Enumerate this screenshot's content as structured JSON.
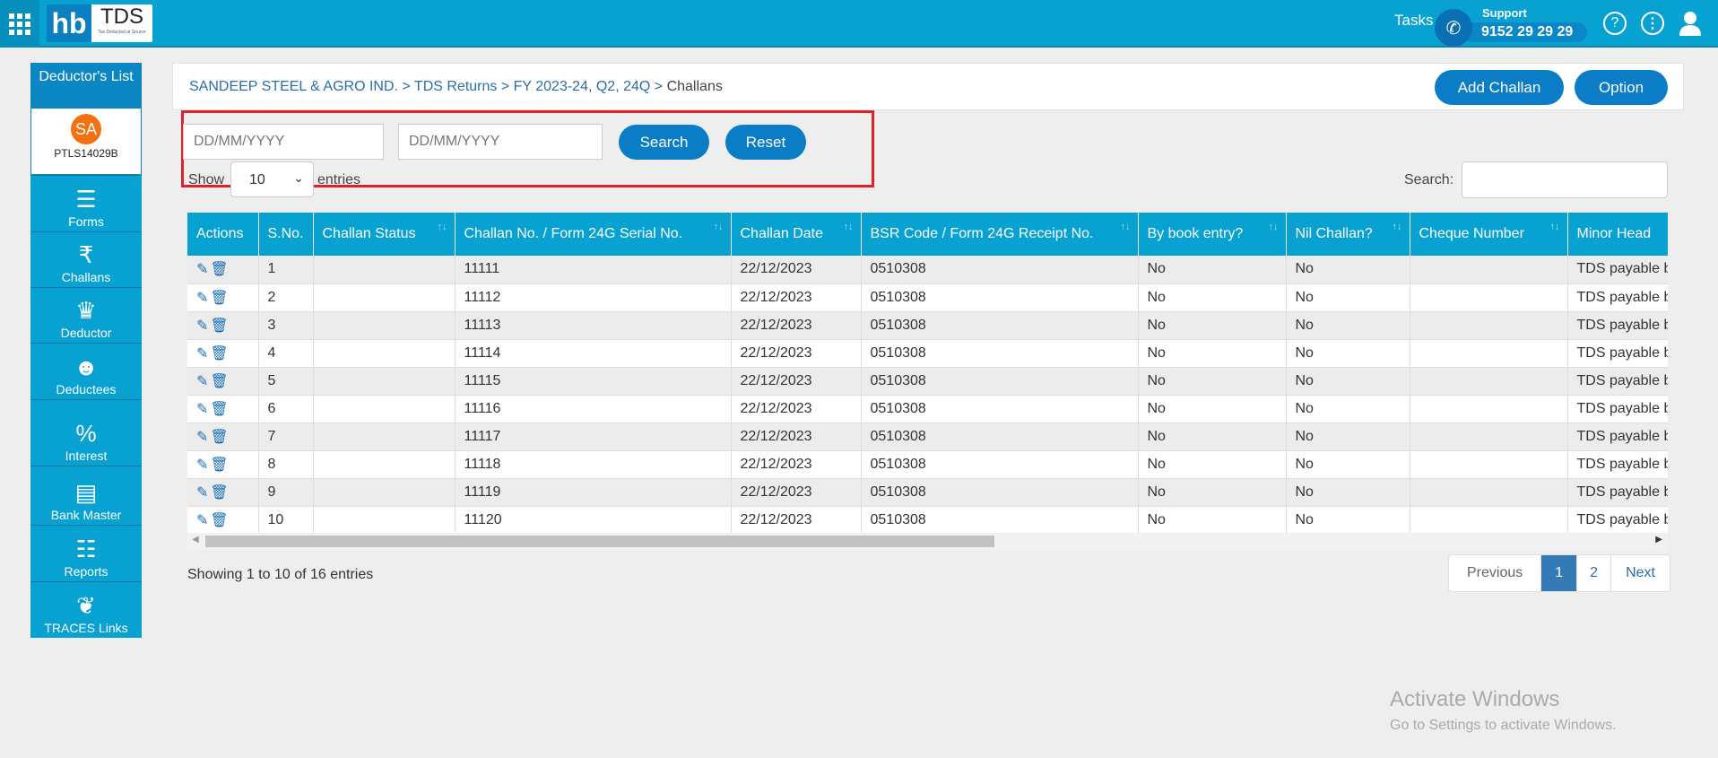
{
  "topbar": {
    "logo": {
      "hb": "hb",
      "tds": "TDS",
      "tagline": "Tax Deducted at Source"
    },
    "tasks_label": "Tasks",
    "support_label": "Support",
    "support_number": "9152 29 29 29",
    "icons": [
      "apps-grid-icon",
      "phone-icon",
      "help-icon",
      "more-vertical-icon",
      "user-icon"
    ]
  },
  "sidebar": {
    "header": "Deductor's List",
    "avatar_initials": "SA",
    "avatar_color": "#f5700f",
    "deductor_code": "PTLS14029B",
    "items": [
      {
        "label": "Forms",
        "icon": "forms-icon"
      },
      {
        "label": "Challans",
        "icon": "challan-receipt-icon"
      },
      {
        "label": "Deductor",
        "icon": "crown-icon"
      },
      {
        "label": "Deductees",
        "icon": "person-icon"
      },
      {
        "label": "Interest",
        "icon": "money-bag-icon"
      },
      {
        "label": "Bank Master",
        "icon": "bank-document-icon"
      },
      {
        "label": "Reports",
        "icon": "report-clipboard-icon"
      },
      {
        "label": "TRACES Links",
        "icon": "traces-logo-icon"
      }
    ]
  },
  "breadcrumb": {
    "items": [
      "SANDEEP STEEL & AGRO IND.",
      "TDS Returns",
      "FY 2023-24, Q2, 24Q"
    ],
    "separator": ">",
    "current": "Challans"
  },
  "actions": {
    "add_challan": "Add Challan",
    "option": "Option"
  },
  "filter": {
    "from_placeholder": "DD/MM/YYYY",
    "to_placeholder": "DD/MM/YYYY",
    "search_button": "Search",
    "reset_button": "Reset",
    "highlight_color": "#e02027"
  },
  "length": {
    "show": "Show",
    "value": "10",
    "entries": "entries"
  },
  "search": {
    "label": "Search:",
    "value": ""
  },
  "table": {
    "columns": [
      "Actions",
      "S.No.",
      "Challan Status",
      "Challan No. / Form 24G Serial No.",
      "Challan Date",
      "BSR Code / Form 24G Receipt No.",
      "By book entry?",
      "Nil Challan?",
      "Cheque Number",
      "Minor Head"
    ],
    "rows": [
      [
        "1",
        "",
        "11111",
        "22/12/2023",
        "0510308",
        "No",
        "No",
        "",
        "TDS payable by"
      ],
      [
        "2",
        "",
        "11112",
        "22/12/2023",
        "0510308",
        "No",
        "No",
        "",
        "TDS payable by"
      ],
      [
        "3",
        "",
        "11113",
        "22/12/2023",
        "0510308",
        "No",
        "No",
        "",
        "TDS payable by"
      ],
      [
        "4",
        "",
        "11114",
        "22/12/2023",
        "0510308",
        "No",
        "No",
        "",
        "TDS payable by"
      ],
      [
        "5",
        "",
        "11115",
        "22/12/2023",
        "0510308",
        "No",
        "No",
        "",
        "TDS payable by"
      ],
      [
        "6",
        "",
        "11116",
        "22/12/2023",
        "0510308",
        "No",
        "No",
        "",
        "TDS payable by"
      ],
      [
        "7",
        "",
        "11117",
        "22/12/2023",
        "0510308",
        "No",
        "No",
        "",
        "TDS payable by"
      ],
      [
        "8",
        "",
        "11118",
        "22/12/2023",
        "0510308",
        "No",
        "No",
        "",
        "TDS payable by"
      ],
      [
        "9",
        "",
        "11119",
        "22/12/2023",
        "0510308",
        "No",
        "No",
        "",
        "TDS payable by"
      ],
      [
        "10",
        "",
        "11120",
        "22/12/2023",
        "0510308",
        "No",
        "No",
        "",
        "TDS payable by"
      ]
    ]
  },
  "info": "Showing 1 to 10 of 16 entries",
  "pagination": {
    "previous": "Previous",
    "pages": [
      "1",
      "2"
    ],
    "current": "1",
    "next": "Next"
  },
  "watermark": {
    "title": "Activate Windows",
    "subtitle": "Go to Settings to activate Windows."
  }
}
